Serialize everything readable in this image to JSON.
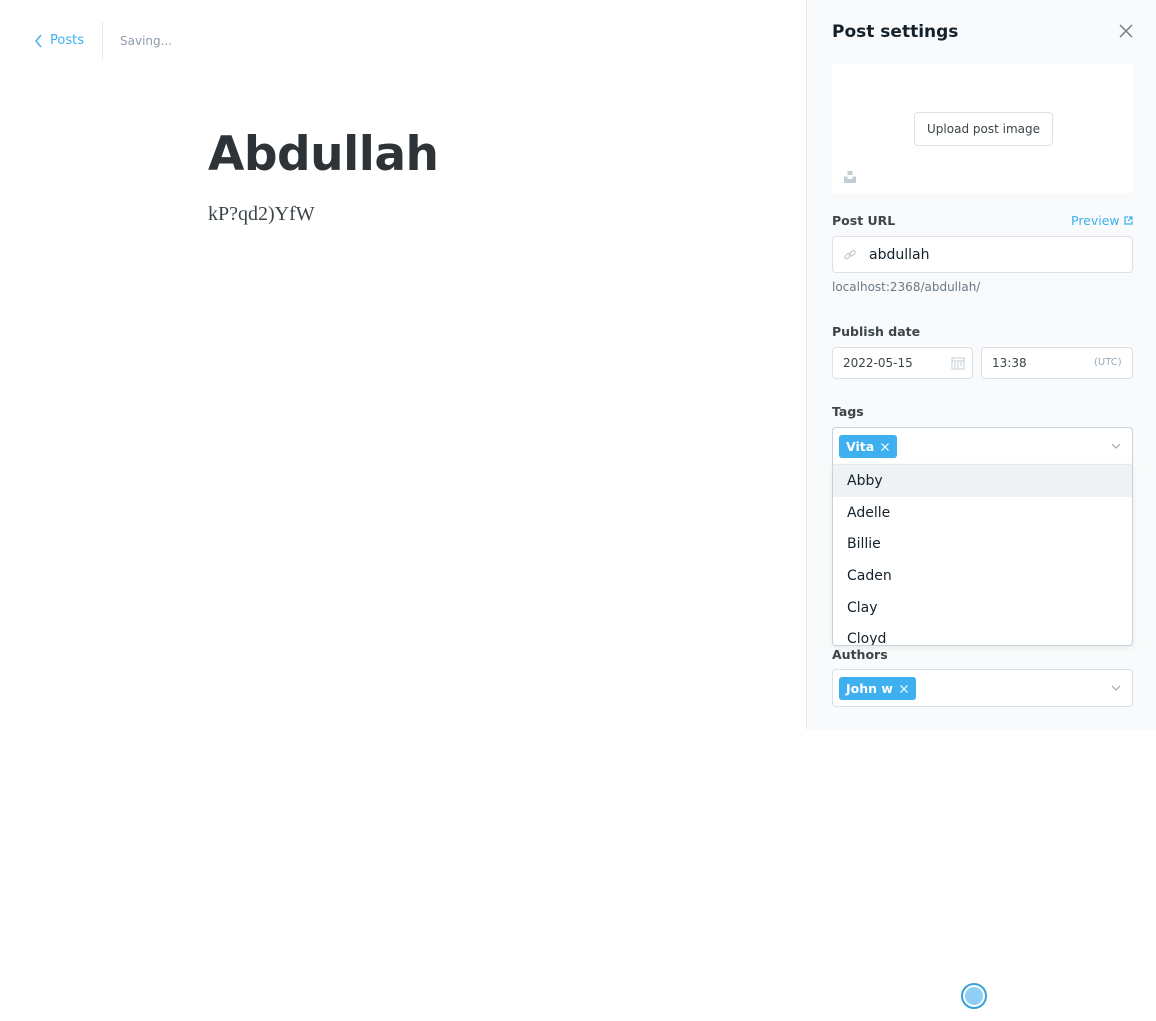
{
  "header": {
    "back_label": "Posts",
    "status": "Saving..."
  },
  "post": {
    "title": "Abdullah",
    "body": "kP?qd2)YfW"
  },
  "settings": {
    "title": "Post settings",
    "upload_label": "Upload post image",
    "url_label": "Post URL",
    "preview_label": "Preview",
    "slug": "abdullah",
    "url_help": "localhost:2368/abdullah/",
    "publish_label": "Publish date",
    "date": "2022-05-15",
    "time": "13:38",
    "timezone": "(UTC)",
    "tags_label": "Tags",
    "tags": [
      "Vita"
    ],
    "tag_options": [
      "Abby",
      "Adelle",
      "Billie",
      "Caden",
      "Clay",
      "Cloyd"
    ],
    "authors_label": "Authors",
    "authors": [
      "John w"
    ]
  },
  "colors": {
    "accent": "#3eb0ef",
    "panel_bg": "#f8fafb",
    "title_text": "#2e3338"
  }
}
